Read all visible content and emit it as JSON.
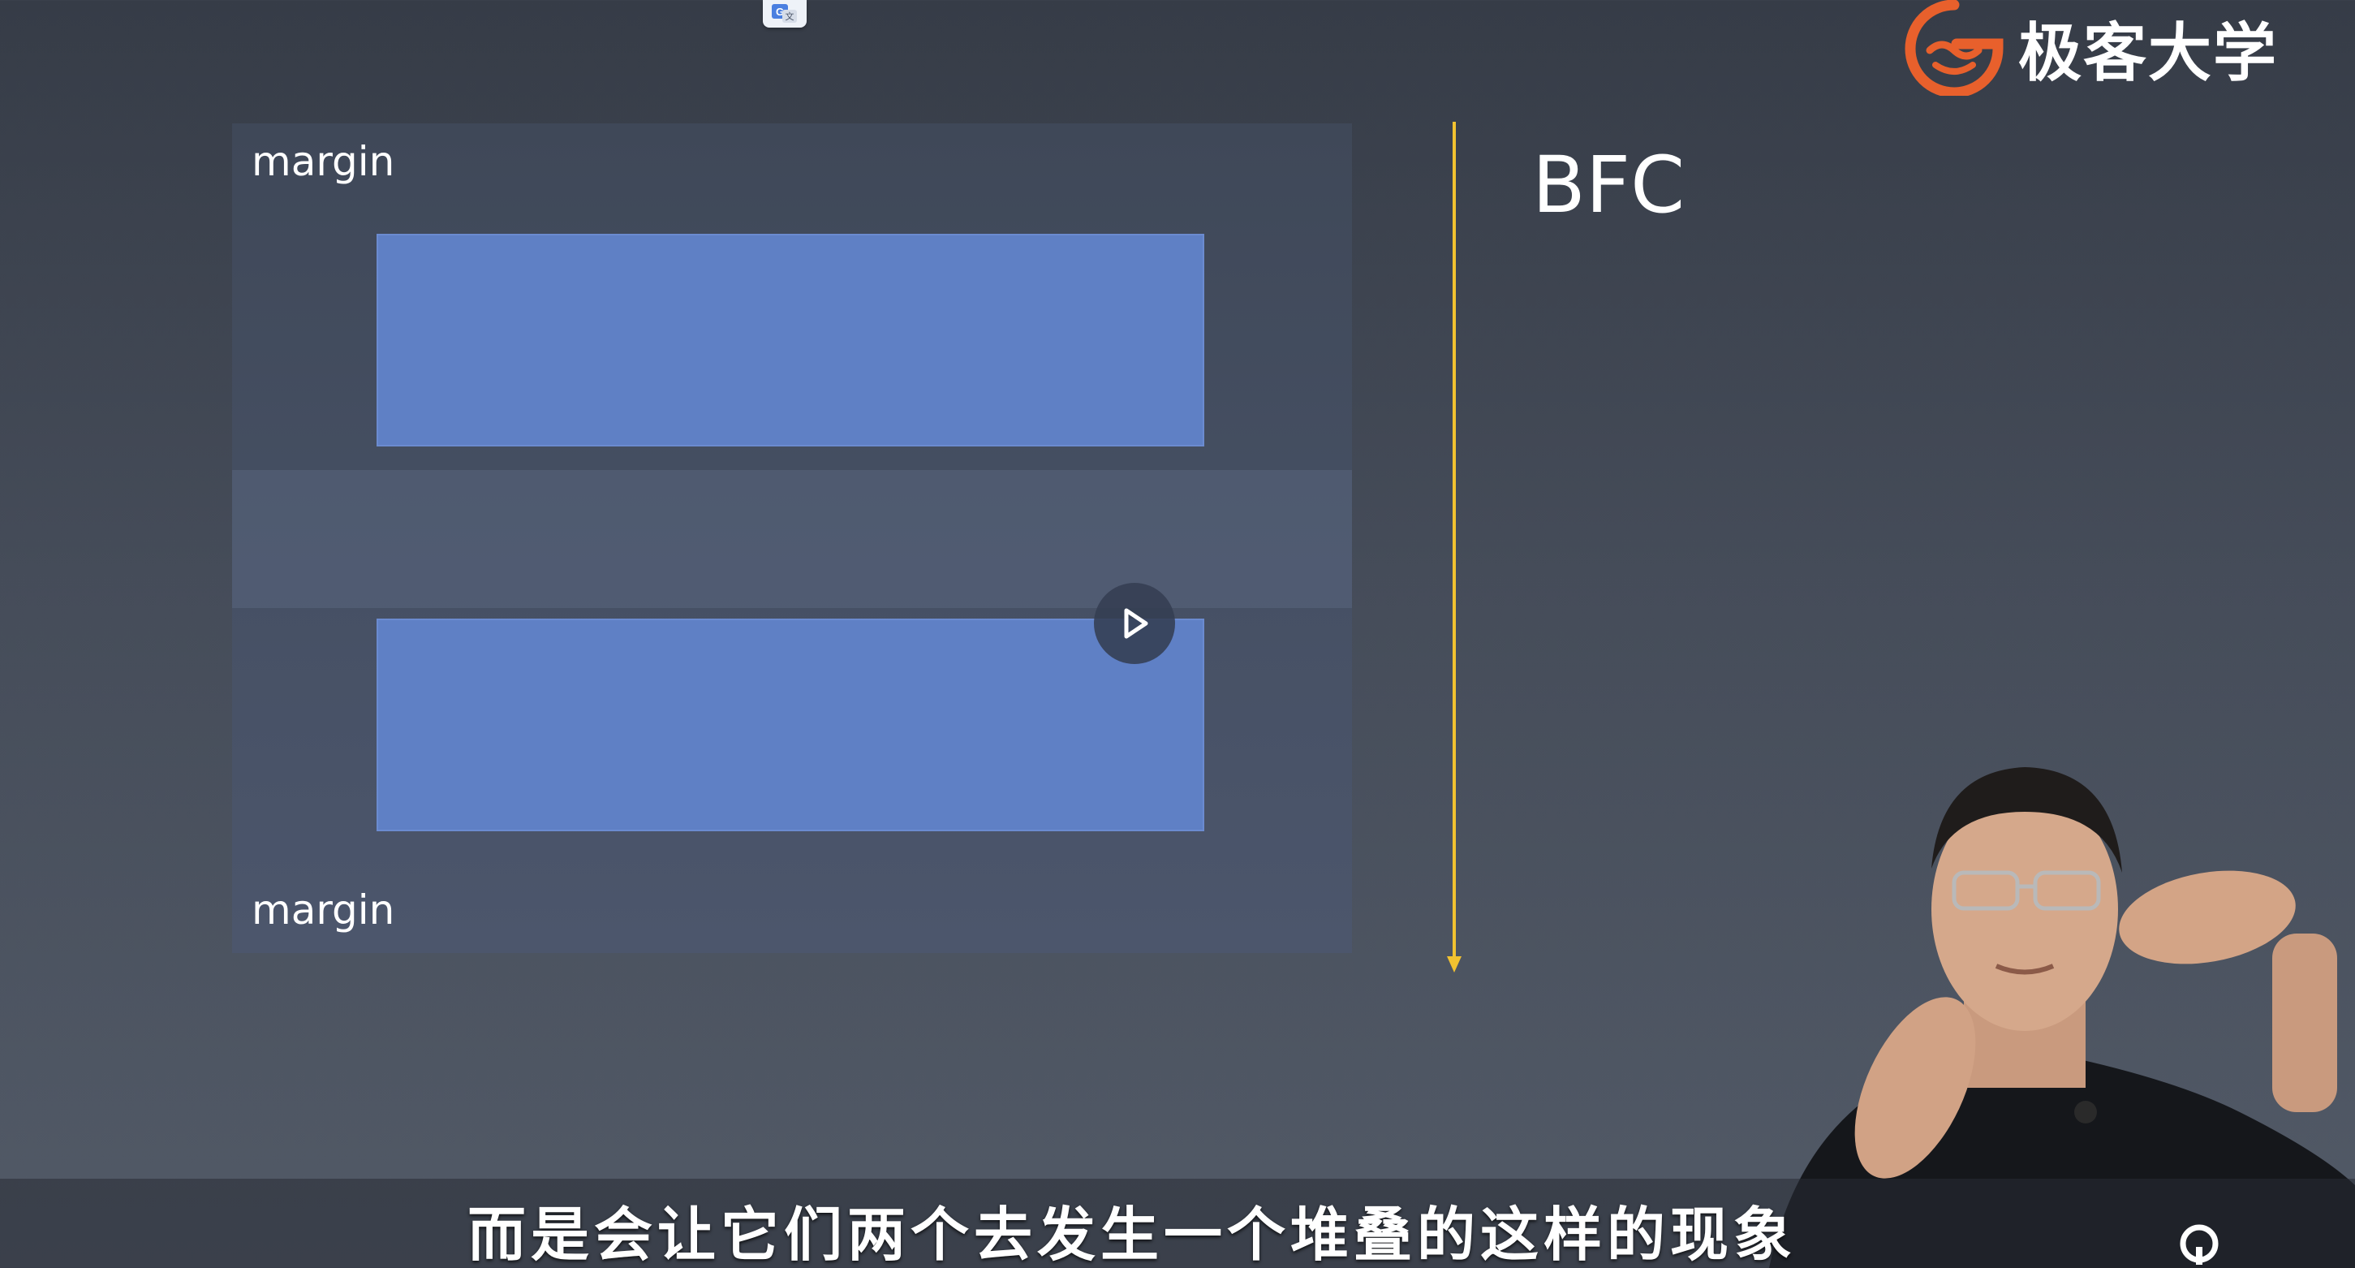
{
  "brand": {
    "name": "极客大学",
    "accent": "#e8602c"
  },
  "slide": {
    "title": "BFC",
    "margin_top_label": "margin",
    "margin_bottom_label": "margin",
    "block_color": "#5f80c5",
    "arrow_color": "#f2c230"
  },
  "video": {
    "play_icon": "play-icon",
    "subtitle": "而是会让它们两个去发生一个堆叠的这样的现象"
  }
}
